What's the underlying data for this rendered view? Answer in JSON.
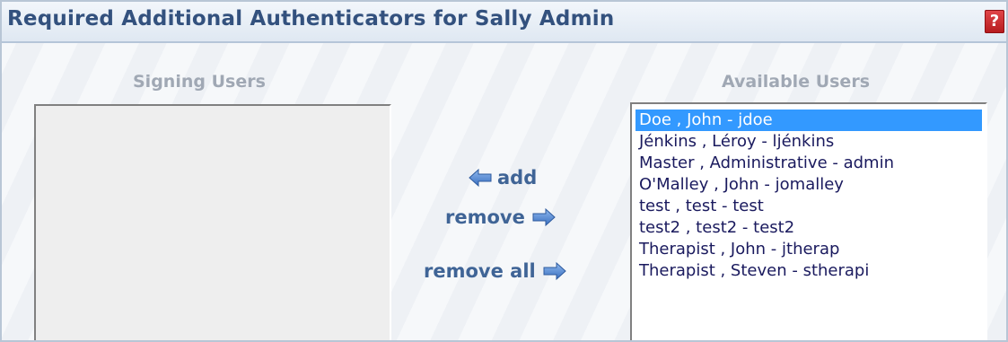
{
  "title": "Required Additional Authenticators for Sally Admin",
  "help_icon": "?",
  "signing_users": {
    "label": "Signing Users",
    "items": []
  },
  "available_users": {
    "label": "Available Users",
    "items": [
      "Doe , John  - jdoe",
      "Jénkins , Léroy  - ljénkins",
      "Master , Administrative  - admin",
      "O'Malley , John  - jomalley",
      "test , test  - test",
      "test2 , test2  - test2",
      "Therapist , John  - jtherap",
      "Therapist , Steven  - stherapi"
    ],
    "selected_index": 0
  },
  "actions": {
    "add": "add",
    "remove": "remove",
    "remove_all": "remove all"
  },
  "colors": {
    "title": "#33517e",
    "action_text": "#3f6496",
    "selection": "#3399ff",
    "help_icon": "#c8282b",
    "arrow": "#5b8fd6"
  },
  "icons": {
    "add": "arrow-left-icon",
    "remove": "arrow-right-icon",
    "remove_all": "arrow-right-icon",
    "help": "help-icon"
  }
}
